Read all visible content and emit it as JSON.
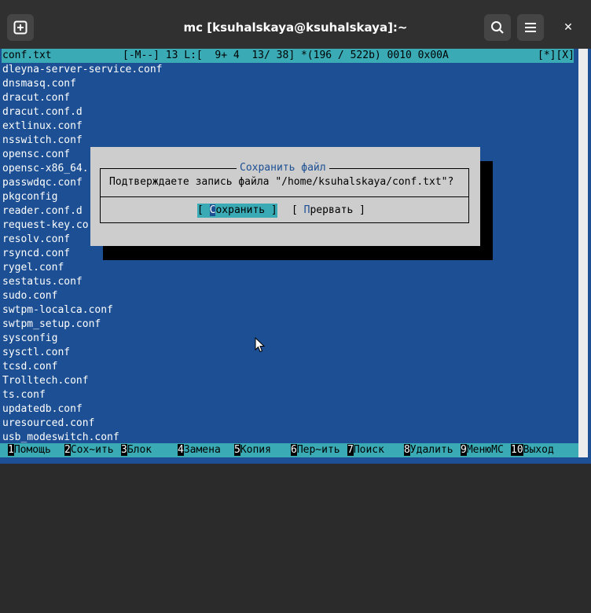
{
  "window": {
    "title": "mc [ksuhalskaya@ksuhalskaya]:~",
    "new_tab_icon": "plus-square-icon",
    "search_icon": "search-icon",
    "menu_icon": "hamburger-menu-icon",
    "close_icon": "close-icon",
    "close_glyph": "✕"
  },
  "editor": {
    "status": {
      "filename": "conf.txt",
      "mode": "[-M--] 13 L:[  9+ 4  13/ 38] *(196 / 522b) 0010 0x00A",
      "flags": "[*][X]"
    },
    "lines": [
      "dleyna-server-service.conf",
      "dnsmasq.conf",
      "dracut.conf",
      "dracut.conf.d",
      "extlinux.conf",
      "nsswitch.conf",
      "opensc.conf",
      "opensc-x86_64.",
      "passwdqc.conf",
      "pkgconfig",
      "reader.conf.d",
      "request-key.co",
      "resolv.conf",
      "rsyncd.conf",
      "rygel.conf",
      "sestatus.conf",
      "sudo.conf",
      "swtpm-localca.conf",
      "swtpm_setup.conf",
      "sysconfig",
      "sysctl.conf",
      "tcsd.conf",
      "Trolltech.conf",
      "ts.conf",
      "updatedb.conf",
      "uresourced.conf",
      "usb_modeswitch.conf"
    ]
  },
  "dialog": {
    "title": "Сохранить файл",
    "message": "Подтверждаете запись файла \"/home/ksuhalskaya/conf.txt\"?",
    "save": {
      "open": "[ ",
      "hotkey": "С",
      "rest": "охранить",
      "close": " ]"
    },
    "abort": {
      "open": "[ ",
      "hotkey": "П",
      "rest": "рервать",
      "close": " ]"
    }
  },
  "function_keys": [
    {
      "num": "1",
      "label": "Помощь"
    },
    {
      "num": "2",
      "label": "Сох~ить"
    },
    {
      "num": "3",
      "label": "Блок"
    },
    {
      "num": "4",
      "label": "Замена"
    },
    {
      "num": "5",
      "label": "Копия"
    },
    {
      "num": "6",
      "label": "Пер~ить"
    },
    {
      "num": "7",
      "label": "Поиск"
    },
    {
      "num": "8",
      "label": "Удалить"
    },
    {
      "num": "9",
      "label": "МенюMC"
    },
    {
      "num": "10",
      "label": "Выход"
    }
  ],
  "colors": {
    "terminal_bg": "#1c4f93",
    "statusbar_bg": "#3aaab5",
    "dialog_bg": "#cdcdcd",
    "titlebar_bg": "#303030"
  }
}
